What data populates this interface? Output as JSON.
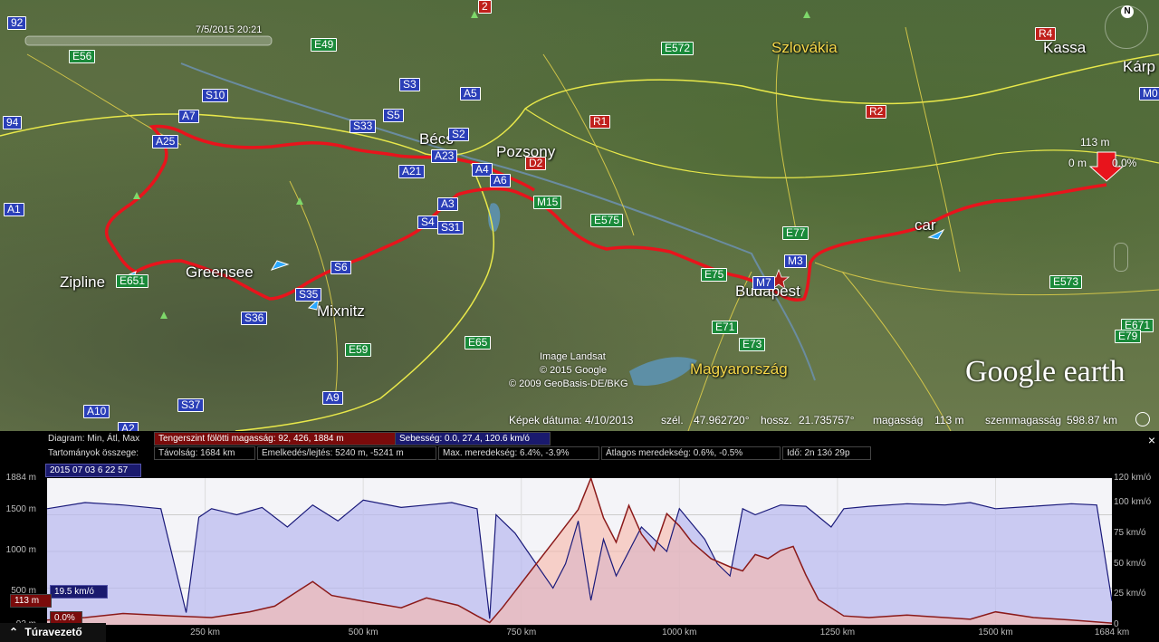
{
  "map": {
    "time_slider": {
      "label": "7/5/2015  20:21"
    },
    "countries": [
      {
        "name": "Szlovákia",
        "key": "szlovakia"
      },
      {
        "name": "Magyarország",
        "key": "magyarorszag"
      }
    ],
    "cities": [
      {
        "name": "Bécs",
        "key": "becs"
      },
      {
        "name": "Pozsony",
        "key": "pozsony"
      },
      {
        "name": "Budapest",
        "key": "budapest"
      },
      {
        "name": "Kassa",
        "key": "kassa"
      },
      {
        "name": "Kárp",
        "key": "karp"
      }
    ],
    "places": [
      {
        "name": "Zipline",
        "key": "zipline"
      },
      {
        "name": "Greensee",
        "key": "greensee"
      },
      {
        "name": "Mixnitz",
        "key": "mixnitz"
      },
      {
        "name": "car",
        "key": "car"
      }
    ],
    "road_shields": [
      {
        "label": "92",
        "color": "blue"
      },
      {
        "label": "E56",
        "color": "green"
      },
      {
        "label": "E49",
        "color": "green"
      },
      {
        "label": "S3",
        "color": "blue"
      },
      {
        "label": "A5",
        "color": "blue"
      },
      {
        "label": "S10",
        "color": "blue"
      },
      {
        "label": "S5",
        "color": "blue"
      },
      {
        "label": "S33",
        "color": "blue"
      },
      {
        "label": "A7",
        "color": "blue"
      },
      {
        "label": "A25",
        "color": "blue"
      },
      {
        "label": "S2",
        "color": "blue"
      },
      {
        "label": "A23",
        "color": "blue"
      },
      {
        "label": "A21",
        "color": "blue"
      },
      {
        "label": "A4",
        "color": "blue"
      },
      {
        "label": "A6",
        "color": "blue"
      },
      {
        "label": "D2",
        "color": "red"
      },
      {
        "label": "A3",
        "color": "blue"
      },
      {
        "label": "S4",
        "color": "blue"
      },
      {
        "label": "S31",
        "color": "blue"
      },
      {
        "label": "M15",
        "color": "green"
      },
      {
        "label": "E575",
        "color": "green"
      },
      {
        "label": "E572",
        "color": "green"
      },
      {
        "label": "R1",
        "color": "red"
      },
      {
        "label": "R2",
        "color": "red"
      },
      {
        "label": "R4",
        "color": "red"
      },
      {
        "label": "E77",
        "color": "green"
      },
      {
        "label": "M3",
        "color": "blue"
      },
      {
        "label": "E75",
        "color": "green"
      },
      {
        "label": "M7",
        "color": "blue"
      },
      {
        "label": "E71",
        "color": "green"
      },
      {
        "label": "E73",
        "color": "green"
      },
      {
        "label": "E573",
        "color": "green"
      },
      {
        "label": "E671",
        "color": "green"
      },
      {
        "label": "E79",
        "color": "green"
      },
      {
        "label": "M0",
        "color": "blue"
      },
      {
        "label": "94",
        "color": "blue"
      },
      {
        "label": "A1",
        "color": "blue"
      },
      {
        "label": "E651",
        "color": "green"
      },
      {
        "label": "S6",
        "color": "blue"
      },
      {
        "label": "S35",
        "color": "blue"
      },
      {
        "label": "S36",
        "color": "blue"
      },
      {
        "label": "E59",
        "color": "green"
      },
      {
        "label": "E65",
        "color": "green"
      },
      {
        "label": "A9",
        "color": "blue"
      },
      {
        "label": "S37",
        "color": "blue"
      },
      {
        "label": "A10",
        "color": "blue"
      },
      {
        "label": "A2",
        "color": "blue"
      },
      {
        "label": "2",
        "color": "red"
      }
    ],
    "marker": {
      "elevation": "113 m",
      "zero": "0 m",
      "percent": "0.0%"
    },
    "credits": {
      "line1": "Image Landsat",
      "line2": "© 2015 Google",
      "line3": "© 2009 GeoBasis-DE/BKG"
    },
    "logo": "Google earth",
    "compass_letter": "N",
    "colors": {
      "route": "#e8141c",
      "border": "#e8e84a"
    }
  },
  "status_bar": {
    "date_label": "Képek dátuma: 4/10/2013",
    "lat_label": "szél.",
    "lat_value": "47.962720°",
    "lon_label": "hossz.",
    "lon_value": "21.735757°",
    "alt_label": "magasság",
    "alt_value": "113 m",
    "eye_label": "szemmagasság",
    "eye_value": "598.87 km"
  },
  "elevation_panel": {
    "diagram_label": "Diagram: Min, Átl, Max",
    "elevation_box": "Tengerszint fölötti magasság: 92, 426, 1884 m",
    "speed_box": "Sebesség: 0.0, 27.4, 120.6 km/ó",
    "summary_label": "Tartományok összege:",
    "distance_box": "Távolság: 1684 km",
    "gain_box": "Emelkedés/lejtés: 5240 m, -5241 m",
    "max_slope_box": "Max. meredekség: 6.4%, -3.9%",
    "avg_slope_box": "Átlagos meredekség: 0.6%, -0.5%",
    "time_box": "Idő: 2n 13ó 29p",
    "timestamp": "2015 07 03   6 22 57",
    "cursor_speed": "19.5 km/ó",
    "cursor_elevation": "113 m",
    "cursor_grade": "0.0%",
    "tour_button": "Túravezető",
    "close_symbol": "×",
    "colors": {
      "elevation_line": "#8b1a1a",
      "elevation_fill": "#f7b5a8",
      "speed_line": "#1a1a7a",
      "speed_fill": "#b8b8f0"
    }
  },
  "chart_data": {
    "type": "line",
    "xlabel": "",
    "ylabel": "",
    "x_unit": "km",
    "xlim": [
      0,
      1684
    ],
    "x_ticks": [
      "250 km",
      "500 km",
      "750 km",
      "1000 km",
      "1250 km",
      "1500 km",
      "1684 km"
    ],
    "y_left_ticks": [
      "1884 m",
      "1500 m",
      "1000 m",
      "500 m",
      "113 m",
      "92 m"
    ],
    "y_left_lim": [
      92,
      1884
    ],
    "y_right_ticks": [
      "120 km/ó",
      "100 km/ó",
      "75 km/ó",
      "50 km/ó",
      "25 km/ó",
      "0"
    ],
    "y_right_lim": [
      0,
      120
    ],
    "series": [
      {
        "name": "Tengerszint fölötti magasság",
        "axis": "left",
        "x": [
          0,
          60,
          120,
          200,
          260,
          320,
          360,
          400,
          420,
          450,
          500,
          560,
          600,
          650,
          680,
          700,
          720,
          760,
          800,
          840,
          860,
          880,
          900,
          920,
          940,
          960,
          980,
          1000,
          1020,
          1050,
          1080,
          1100,
          1120,
          1140,
          1160,
          1180,
          1200,
          1220,
          1260,
          1300,
          1360,
          1420,
          1460,
          1500,
          1560,
          1620,
          1684
        ],
        "values": [
          150,
          180,
          230,
          200,
          180,
          250,
          320,
          520,
          620,
          450,
          380,
          300,
          420,
          330,
          200,
          120,
          300,
          700,
          1100,
          1500,
          1884,
          1400,
          1100,
          1550,
          1200,
          1000,
          1450,
          1300,
          1100,
          900,
          800,
          750,
          950,
          900,
          1000,
          1050,
          700,
          400,
          200,
          180,
          210,
          180,
          160,
          250,
          180,
          150,
          113
        ]
      },
      {
        "name": "Sebesség",
        "axis": "right",
        "x": [
          0,
          60,
          120,
          180,
          220,
          240,
          260,
          300,
          340,
          380,
          420,
          460,
          500,
          560,
          600,
          640,
          680,
          700,
          710,
          740,
          760,
          800,
          820,
          840,
          860,
          880,
          900,
          940,
          980,
          1000,
          1040,
          1060,
          1080,
          1100,
          1120,
          1160,
          1200,
          1240,
          1260,
          1300,
          1360,
          1420,
          1460,
          1500,
          1560,
          1620,
          1660,
          1684
        ],
        "values": [
          95,
          100,
          98,
          95,
          10,
          88,
          95,
          90,
          96,
          80,
          98,
          85,
          102,
          96,
          98,
          100,
          95,
          5,
          90,
          75,
          60,
          30,
          50,
          85,
          20,
          70,
          40,
          80,
          60,
          95,
          70,
          50,
          40,
          95,
          90,
          98,
          97,
          80,
          95,
          97,
          99,
          98,
          100,
          95,
          97,
          99,
          98,
          19.5
        ]
      }
    ],
    "grid": true,
    "legend": "none"
  }
}
